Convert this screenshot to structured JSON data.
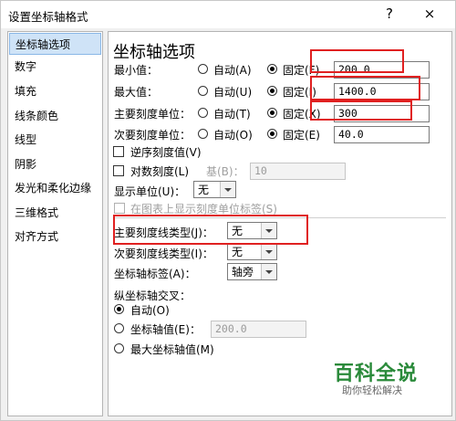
{
  "dialog": {
    "title": "设置坐标轴格式",
    "help_glyph": "?",
    "close_glyph": "×"
  },
  "sidebar": {
    "items": [
      {
        "label": "坐标轴选项",
        "selected": true
      },
      {
        "label": "数字"
      },
      {
        "label": "填充"
      },
      {
        "label": "线条颜色"
      },
      {
        "label": "线型"
      },
      {
        "label": "阴影"
      },
      {
        "label": "发光和柔化边缘"
      },
      {
        "label": "三维格式"
      },
      {
        "label": "对齐方式"
      }
    ]
  },
  "panel": {
    "heading": "坐标轴选项",
    "min": {
      "label": "最小值：",
      "auto": "自动(A)",
      "fixed": "固定(F)",
      "value": "200.0",
      "selected": "fixed"
    },
    "max": {
      "label": "最大值：",
      "auto": "自动(U)",
      "fixed": "固定(I)",
      "value": "1400.0",
      "selected": "fixed"
    },
    "major": {
      "label": "主要刻度单位：",
      "auto": "自动(T)",
      "fixed": "固定(X)",
      "value": "300",
      "selected": "fixed"
    },
    "minor": {
      "label": "次要刻度单位：",
      "auto": "自动(O)",
      "fixed": "固定(E)",
      "value": "40.0",
      "selected": "fixed"
    },
    "reverse": {
      "label": "逆序刻度值(V)",
      "checked": false
    },
    "log": {
      "label": "对数刻度(L)",
      "base_label": "基(B)：",
      "base_value": "10",
      "checked": false
    },
    "display_units": {
      "label": "显示单位(U)：",
      "value": "无"
    },
    "show_units_label": {
      "label": "在图表上显示刻度单位标签(S)",
      "enabled": false
    },
    "major_tick_type": {
      "label": "主要刻度线类型(J)：",
      "value": "无"
    },
    "minor_tick_type": {
      "label": "次要刻度线类型(I)：",
      "value": "无"
    },
    "axis_labels": {
      "label": "坐标轴标签(A)：",
      "value": "轴旁"
    },
    "cross": {
      "title": "纵坐标轴交叉：",
      "auto": "自动(O)",
      "value_label": "坐标轴值(E)：",
      "value": "200.0",
      "max_label": "最大坐标轴值(M)",
      "selected": "auto"
    }
  },
  "watermark": {
    "main": "百科全说",
    "sub": "助你轻松解决"
  },
  "colors": {
    "highlight": "#e02020",
    "selection": "#cfe3f7",
    "watermark": "#2a8a3a"
  }
}
